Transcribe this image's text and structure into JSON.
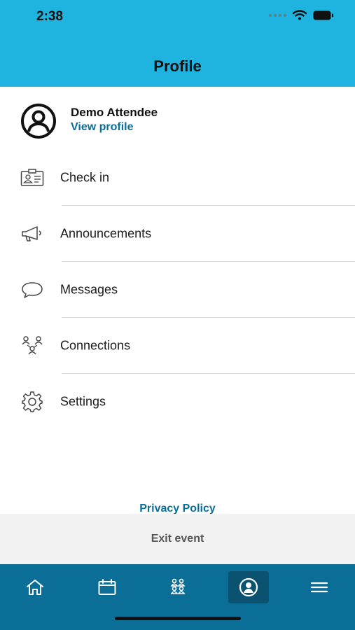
{
  "status_bar": {
    "time": "2:38"
  },
  "header": {
    "title": "Profile",
    "bg_color": "#1fb3e0"
  },
  "profile": {
    "name": "Demo Attendee",
    "link": "View profile",
    "icon": "user-circle-icon"
  },
  "menu": [
    {
      "label": "Check in",
      "icon": "id-badge-icon"
    },
    {
      "label": "Announcements",
      "icon": "megaphone-icon"
    },
    {
      "label": "Messages",
      "icon": "speech-bubble-icon"
    },
    {
      "label": "Connections",
      "icon": "people-network-icon"
    },
    {
      "label": "Settings",
      "icon": "gear-icon"
    }
  ],
  "footer": {
    "privacy_link": "Privacy Policy",
    "exit_label": "Exit event"
  },
  "tab_bar": {
    "bg_color": "#0b6e96",
    "tabs": [
      {
        "name": "home",
        "icon": "home-icon",
        "active": false
      },
      {
        "name": "agenda",
        "icon": "calendar-icon",
        "active": false
      },
      {
        "name": "attendees",
        "icon": "people-icon",
        "active": false
      },
      {
        "name": "profile",
        "icon": "user-circle-icon",
        "active": true
      },
      {
        "name": "menu",
        "icon": "hamburger-menu-icon",
        "active": false
      }
    ]
  }
}
